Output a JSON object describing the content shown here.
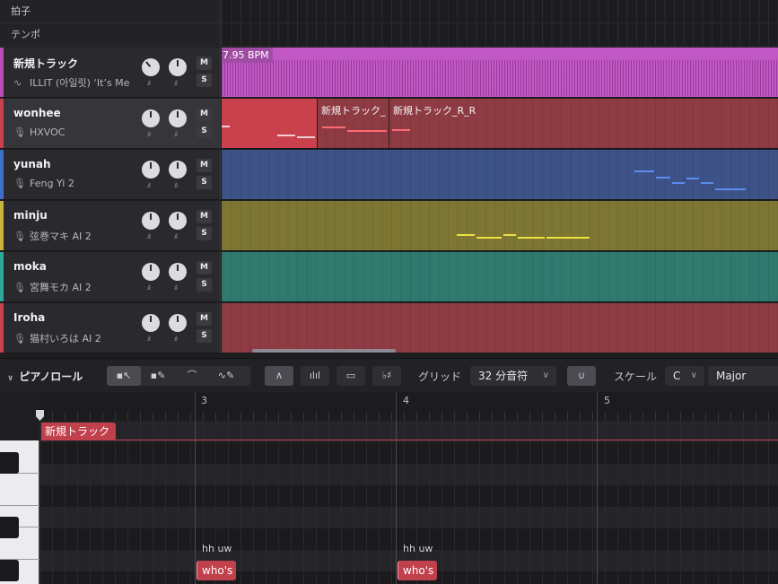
{
  "meta_rows": {
    "beat_label": "拍子",
    "tempo_label": "テンポ"
  },
  "tracks": [
    {
      "name": "新規トラック",
      "sub": "ILLIT (아일릿) ‘It’s Me",
      "sub_icon": "waveform-icon",
      "color": "#b94cb9",
      "mute": "M",
      "solo": "S"
    },
    {
      "name": "wonhee",
      "sub": "HXVOC",
      "sub_icon": "mic-icon",
      "color": "#c8414d",
      "mute": "M",
      "solo": "S"
    },
    {
      "name": "yunah",
      "sub": "Feng Yi 2",
      "sub_icon": "mic-icon",
      "color": "#3f6fc9",
      "mute": "M",
      "solo": "S"
    },
    {
      "name": "minju",
      "sub": "弦巻マキ AI 2",
      "sub_icon": "mic-icon",
      "color": "#c9b43a",
      "mute": "M",
      "solo": "S"
    },
    {
      "name": "moka",
      "sub": "宮舞モカ AI 2",
      "sub_icon": "mic-icon",
      "color": "#2fa99a",
      "mute": "M",
      "solo": "S"
    },
    {
      "name": "Iroha",
      "sub": "猫村いろは AI 2",
      "sub_icon": "mic-icon",
      "color": "#c8414d",
      "mute": "M",
      "solo": "S"
    }
  ],
  "arrangement": {
    "bpm_label": "7.95 BPM",
    "wonhee_clips": [
      "新規トラック_",
      "新規トラック_R_R"
    ]
  },
  "piano_roll": {
    "title": "ピアノロール",
    "grid_label": "グリッド",
    "grid_value": "32 分音符",
    "scale_label": "スケール",
    "scale_key": "C",
    "scale_mode": "Major",
    "bar_numbers": [
      "3",
      "4",
      "5"
    ],
    "track_label": "新規トラック",
    "notes": [
      {
        "phoneme": "hh uw",
        "lyric": "who's"
      },
      {
        "phoneme": "hh uw",
        "lyric": "who's"
      }
    ],
    "accent_color": "#c0414b"
  }
}
